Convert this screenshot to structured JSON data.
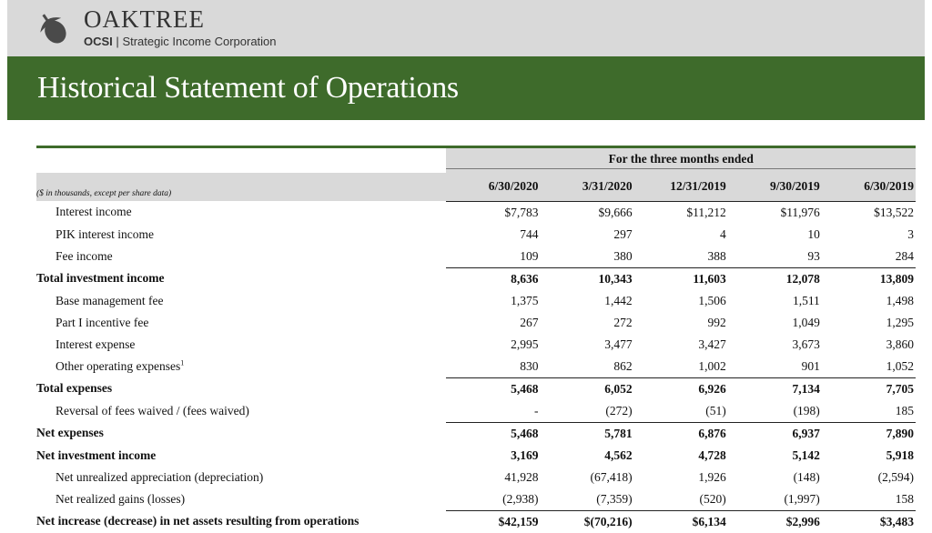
{
  "brand": {
    "name": "OAKTREE",
    "ticker": "OCSI",
    "separator": "|",
    "subtitle": "Strategic Income Corporation"
  },
  "page_title": "Historical Statement of Operations",
  "table": {
    "span_header": "For the three months ended",
    "unit_note": "($ in thousands, except per share data)",
    "columns": [
      "6/30/2020",
      "3/31/2020",
      "12/31/2019",
      "9/30/2019",
      "6/30/2019"
    ],
    "rows": [
      {
        "label": "Interest income",
        "values": [
          "$7,783",
          "$9,666",
          "$11,212",
          "$11,976",
          "$13,522"
        ]
      },
      {
        "label": "PIK interest income",
        "values": [
          "744",
          "297",
          "4",
          "10",
          "3"
        ]
      },
      {
        "label": "Fee income",
        "values": [
          "109",
          "380",
          "388",
          "93",
          "284"
        ]
      },
      {
        "label": "Total investment income",
        "values": [
          "8,636",
          "10,343",
          "11,603",
          "12,078",
          "13,809"
        ]
      },
      {
        "label": "Base management fee",
        "values": [
          "1,375",
          "1,442",
          "1,506",
          "1,511",
          "1,498"
        ]
      },
      {
        "label": "Part I incentive fee",
        "values": [
          "267",
          "272",
          "992",
          "1,049",
          "1,295"
        ]
      },
      {
        "label": "Interest expense",
        "values": [
          "2,995",
          "3,477",
          "3,427",
          "3,673",
          "3,860"
        ]
      },
      {
        "label": "Other operating expenses",
        "footnote": "1",
        "values": [
          "830",
          "862",
          "1,002",
          "901",
          "1,052"
        ]
      },
      {
        "label": "Total expenses",
        "values": [
          "5,468",
          "6,052",
          "6,926",
          "7,134",
          "7,705"
        ]
      },
      {
        "label": "Reversal of fees waived / (fees waived)",
        "values": [
          "-",
          "(272)",
          "(51)",
          "(198)",
          "185"
        ]
      },
      {
        "label": "Net expenses",
        "values": [
          "5,468",
          "5,781",
          "6,876",
          "6,937",
          "7,890"
        ]
      },
      {
        "label": "Net investment income",
        "values": [
          "3,169",
          "4,562",
          "4,728",
          "5,142",
          "5,918"
        ]
      },
      {
        "label": "Net unrealized appreciation (depreciation)",
        "values": [
          "41,928",
          "(67,418)",
          "1,926",
          "(148)",
          "(2,594)"
        ]
      },
      {
        "label": "Net realized gains (losses)",
        "values": [
          "(2,938)",
          "(7,359)",
          "(520)",
          "(1,997)",
          "158"
        ]
      },
      {
        "label": "Net increase (decrease) in net assets resulting from operations",
        "values": [
          "$42,159",
          "$(70,216)",
          "$6,134",
          "$2,996",
          "$3,483"
        ]
      }
    ]
  },
  "colors": {
    "brand_green": "#3e6b2b",
    "header_gray": "#d9d9d9"
  },
  "icons": {
    "logo": "acorn-logo-icon"
  }
}
